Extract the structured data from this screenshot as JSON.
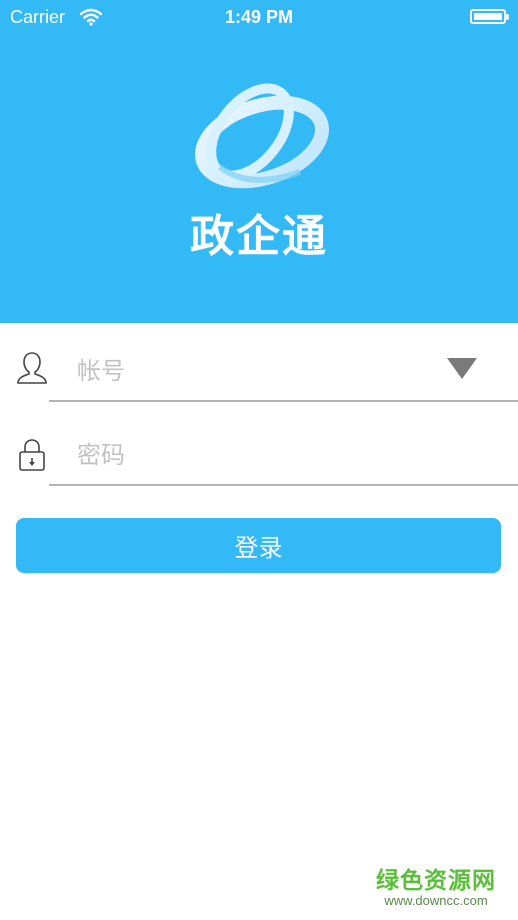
{
  "status_bar": {
    "carrier": "Carrier",
    "time": "1:49 PM",
    "wifi_icon": "wifi-icon",
    "battery_icon": "battery-icon"
  },
  "header": {
    "logo_icon": "orbit-logo-icon",
    "app_name": "政企通",
    "background_color": "#33b9f5"
  },
  "form": {
    "account": {
      "icon": "user-icon",
      "placeholder": "帐号",
      "value": "",
      "dropdown_icon": "triangle-down-icon"
    },
    "password": {
      "icon": "lock-icon",
      "placeholder": "密码",
      "value": ""
    },
    "login_label": "登录",
    "accent_color": "#33b9f5"
  },
  "watermark": {
    "name": "绿色资源网",
    "url": "www.downcc.com"
  }
}
